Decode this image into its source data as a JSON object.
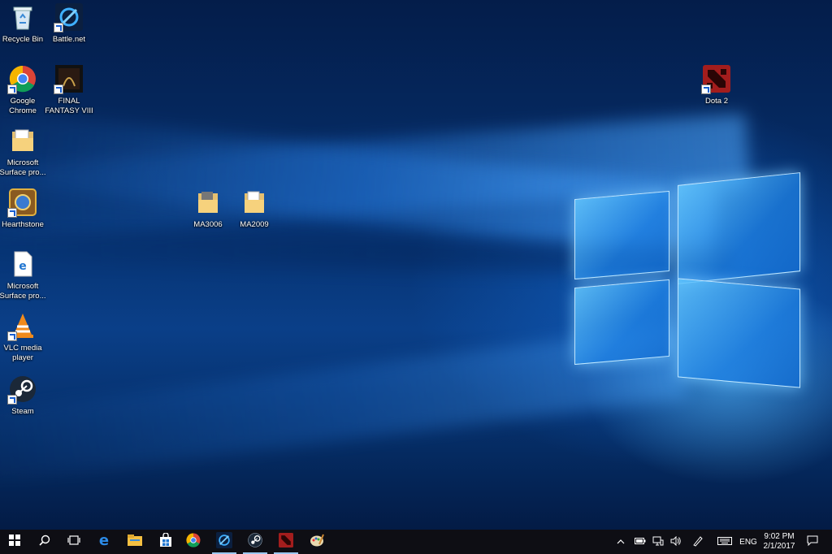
{
  "desktop": {
    "icons": [
      {
        "label": "Recycle Bin",
        "icon": "recycle-bin-icon"
      },
      {
        "label": "Battle.net",
        "icon": "battlenet-icon"
      },
      {
        "label": "Google Chrome",
        "icon": "chrome-icon"
      },
      {
        "label": "FINAL FANTASY VIII",
        "icon": "final-fantasy-icon"
      },
      {
        "label": "Microsoft Surface pro...",
        "icon": "folder-icon"
      },
      {
        "label": "Hearthstone",
        "icon": "hearthstone-icon"
      },
      {
        "label": "MA3006",
        "icon": "folder-icon"
      },
      {
        "label": "MA2009",
        "icon": "folder-icon"
      },
      {
        "label": "Microsoft Surface pro...",
        "icon": "edge-document-icon"
      },
      {
        "label": "VLC media player",
        "icon": "vlc-icon"
      },
      {
        "label": "Steam",
        "icon": "steam-icon"
      },
      {
        "label": "Dota 2",
        "icon": "dota2-icon"
      }
    ]
  },
  "taskbar": {
    "pinned": [
      "start-icon",
      "search-icon",
      "task-view-icon",
      "edge-icon",
      "file-explorer-icon",
      "store-icon",
      "chrome-icon",
      "battlenet-icon",
      "steam-icon",
      "dota2-icon",
      "paint-icon"
    ],
    "tray": {
      "language": "ENG",
      "time": "9:02 PM",
      "date": "2/1/2017"
    }
  },
  "colors": {
    "taskbar": "#0e0e14",
    "desktop_accent": "#0a3f88",
    "active_indicator": "#9ac7f0"
  }
}
